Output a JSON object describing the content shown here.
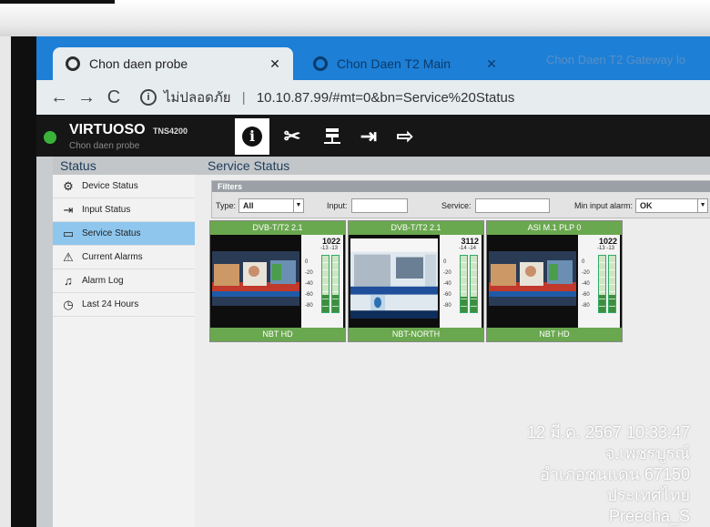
{
  "browser": {
    "tabs": [
      {
        "label": "Chon daen probe",
        "close": "✕"
      },
      {
        "label": "Chon Daen T2 Main",
        "close": "✕"
      },
      {
        "label": "Chon Daen T2 Gateway lo"
      }
    ],
    "nav": {
      "back": "←",
      "forward": "→",
      "reload": "C"
    },
    "address": {
      "security_label": "ไม่ปลอดภัย",
      "separator": "|",
      "url": "10.10.87.99/#mt=0&bn=Service%20Status"
    }
  },
  "app": {
    "brand": "VIRTUOSO",
    "model": "TNS4200",
    "subtitle": "Chon daen probe",
    "toolbar": [
      {
        "name": "info-icon",
        "glyph": "i"
      },
      {
        "name": "tools-icon",
        "glyph": "✂"
      },
      {
        "name": "network-icon",
        "glyph": "≡"
      },
      {
        "name": "login-icon",
        "glyph": "⇥"
      },
      {
        "name": "logout-icon",
        "glyph": "⇨"
      }
    ]
  },
  "sidebar": {
    "title": "Status",
    "items": [
      {
        "label": "Device Status",
        "icon": "device-icon"
      },
      {
        "label": "Input Status",
        "icon": "input-icon"
      },
      {
        "label": "Service Status",
        "icon": "monitor-icon",
        "selected": true
      },
      {
        "label": "Current Alarms",
        "icon": "alarm-icon"
      },
      {
        "label": "Alarm Log",
        "icon": "bell-log-icon"
      },
      {
        "label": "Last 24 Hours",
        "icon": "history-icon"
      }
    ]
  },
  "main": {
    "title": "Service Status",
    "filters": {
      "title": "Filters",
      "type_label": "Type:",
      "type_value": "All",
      "input_label": "Input:",
      "service_label": "Service:",
      "min_alarm_label": "Min input alarm:",
      "min_alarm_value": "OK"
    },
    "services": [
      {
        "header": "DVB-T/T2 2.1",
        "name": "NBT HD",
        "bitrate": "1022",
        "levels": "-13  -13",
        "fill": [
          0.3,
          0.3
        ]
      },
      {
        "header": "DVB-T/T2 2.1",
        "name": "NBT-NORTH",
        "bitrate": "3112",
        "levels": "-14  -14",
        "fill": [
          0.28,
          0.28
        ]
      },
      {
        "header": "ASI M.1 PLP 0",
        "name": "NBT HD",
        "bitrate": "1022",
        "levels": "-13  -13",
        "fill": [
          0.3,
          0.3
        ]
      }
    ],
    "scale_labels": [
      "0",
      "-20",
      "-40",
      "-60",
      "-80"
    ]
  },
  "overlay": {
    "datetime": "12 มี.ค. 2567 10:33:47",
    "province": "จ.เพชรบูรณ์",
    "district": "อำเภอชนแดน 67150",
    "country": "ประเทศไทย",
    "author": "Preecha_S"
  }
}
